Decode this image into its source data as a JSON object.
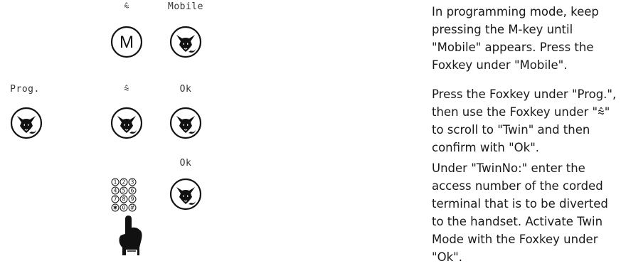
{
  "steps": [
    {
      "labels": [
        "⩯",
        "Mobile"
      ],
      "text": "In programming mode, keep pressing the M-key until \"Mobile\" appears.  Press the Foxkey under \"Mobile\"."
    },
    {
      "labels": [
        "Prog.",
        "⩯",
        "Ok"
      ],
      "text": "Press the Foxkey under \"Prog.\", then use the Foxkey under \"⩯\" to scroll to \"Twin\" and then confirm with \"Ok\"."
    },
    {
      "labels": [
        "Ok"
      ],
      "text": "Under \"TwinNo:\" enter the access number of the corded terminal that is to be diverted to the handset.  Activate Twin Mode with the Foxkey under \"Ok\"."
    }
  ],
  "m_key_letter": "M",
  "keypad_digits": [
    "1",
    "2",
    "3",
    "4",
    "5",
    "6",
    "7",
    "8",
    "9",
    "✱",
    "0",
    "#"
  ],
  "icons": [
    "m-key-icon",
    "foxkey-icon",
    "keypad-icon",
    "hand-pointer-icon"
  ]
}
